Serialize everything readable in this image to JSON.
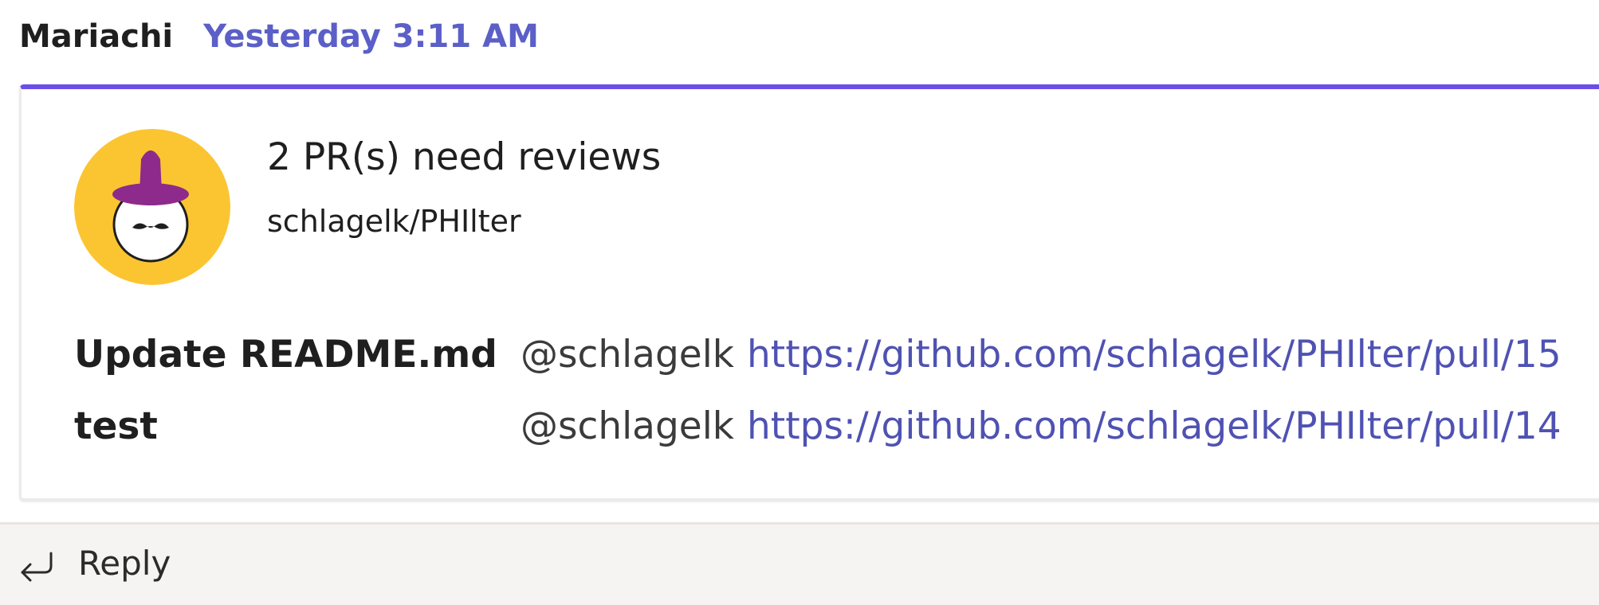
{
  "message": {
    "sender": "Mariachi",
    "timestamp": "Yesterday 3:11 AM"
  },
  "card": {
    "title": "2 PR(s) need reviews",
    "subtitle": "schlagelk/PHIlter",
    "avatar_icon": "mariachi-bot-avatar",
    "pull_requests": [
      {
        "name": "Update README.md",
        "author": "@schlagelk",
        "url": "https://github.com/schlagelk/PHIlter/pull/15"
      },
      {
        "name": "test",
        "author": "@schlagelk",
        "url": "https://github.com/schlagelk/PHIlter/pull/14"
      }
    ]
  },
  "reply": {
    "label": "Reply",
    "icon": "reply-arrow-icon"
  },
  "colors": {
    "timestamp": "#5b5fc7",
    "link": "#4f52b2",
    "card_accent": "#6b4ee8",
    "avatar_bg": "#fbc531",
    "hat": "#8e2a8c",
    "reply_bar_bg": "#f5f4f3"
  }
}
